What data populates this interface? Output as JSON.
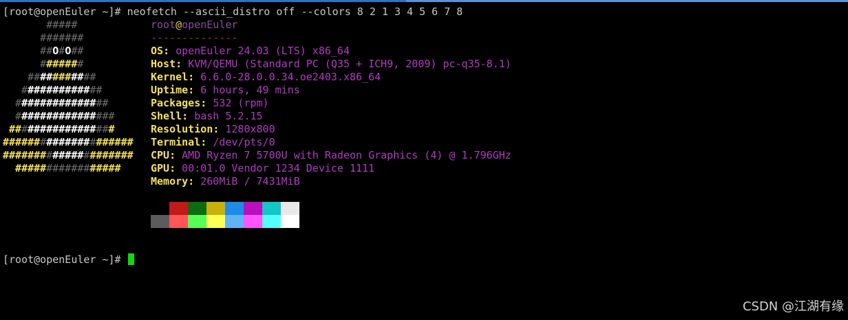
{
  "terminal": {
    "command_line": {
      "prompt": "[root@openEuler ~]# ",
      "command": "neofetch --ascii_distro off --colors 8 2 1 3 4 5 6 7 8"
    },
    "title": {
      "user": "root",
      "at": "@",
      "host": "openEuler"
    },
    "separator": "--------------",
    "info": [
      {
        "key": "OS",
        "value": "openEuler 24.03 (LTS) x86_64"
      },
      {
        "key": "Host",
        "value": "KVM/QEMU (Standard PC (Q35 + ICH9, 2009) pc-q35-8.1)"
      },
      {
        "key": "Kernel",
        "value": "6.6.0-28.0.0.34.oe2403.x86_64"
      },
      {
        "key": "Uptime",
        "value": "6 hours, 49 mins"
      },
      {
        "key": "Packages",
        "value": "532 (rpm)"
      },
      {
        "key": "Shell",
        "value": "bash 5.2.15"
      },
      {
        "key": "Resolution",
        "value": "1280x800"
      },
      {
        "key": "Terminal",
        "value": "/dev/pts/0"
      },
      {
        "key": "CPU",
        "value": "AMD Ryzen 7 5700U with Radeon Graphics (4) @ 1.796GHz"
      },
      {
        "key": "GPU",
        "value": "00:01.0 Vendor 1234 Device 1111"
      },
      {
        "key": "Memory",
        "value": "260MiB / 7431MiB"
      }
    ],
    "info_separator": ": ",
    "ascii_logo": [
      [
        [
          "g",
          "       #####"
        ]
      ],
      [
        [
          "g",
          "      #######"
        ]
      ],
      [
        [
          "g",
          "      ##"
        ],
        [
          "w",
          "O"
        ],
        [
          "g",
          "#"
        ],
        [
          "w",
          "O"
        ],
        [
          "g",
          "##"
        ]
      ],
      [
        [
          "g",
          "      #"
        ],
        [
          "y",
          "#####"
        ],
        [
          "g",
          "#"
        ]
      ],
      [
        [
          "g",
          "    ##"
        ],
        [
          "w",
          "##"
        ],
        [
          "y",
          "###"
        ],
        [
          "w",
          "##"
        ],
        [
          "g",
          "##"
        ]
      ],
      [
        [
          "g",
          "   #"
        ],
        [
          "w",
          "##########"
        ],
        [
          "g",
          "##"
        ]
      ],
      [
        [
          "g",
          "  #"
        ],
        [
          "w",
          "############"
        ],
        [
          "g",
          "##"
        ]
      ],
      [
        [
          "g",
          "  #"
        ],
        [
          "w",
          "############"
        ],
        [
          "g",
          "###"
        ]
      ],
      [
        [
          "y",
          " ##"
        ],
        [
          "g",
          "#"
        ],
        [
          "w",
          "###########"
        ],
        [
          "g",
          "##"
        ],
        [
          "y",
          "#"
        ]
      ],
      [
        [
          "y",
          "######"
        ],
        [
          "g",
          "#"
        ],
        [
          "w",
          "#######"
        ],
        [
          "g",
          "#"
        ],
        [
          "y",
          "######"
        ]
      ],
      [
        [
          "y",
          "#######"
        ],
        [
          "g",
          "#"
        ],
        [
          "w",
          "#####"
        ],
        [
          "g",
          "#"
        ],
        [
          "y",
          "#######"
        ]
      ],
      [
        [
          "y",
          "  #####"
        ],
        [
          "g",
          "#######"
        ],
        [
          "y",
          "#####"
        ]
      ]
    ],
    "palette": {
      "normal": [
        "#000000",
        "#c01a1a",
        "#0f6b0f",
        "#c7b10b",
        "#1c8ce8",
        "#b90fbf",
        "#14c8c8",
        "#e8e8e8"
      ],
      "bright": [
        "#5c5c5c",
        "#ff5555",
        "#55ff55",
        "#ffff55",
        "#5fb4f8",
        "#ff55ff",
        "#55ffff",
        "#ffffff"
      ]
    },
    "final_prompt": "[root@openEuler ~]# "
  },
  "watermark": "CSDN @江湖有缘"
}
